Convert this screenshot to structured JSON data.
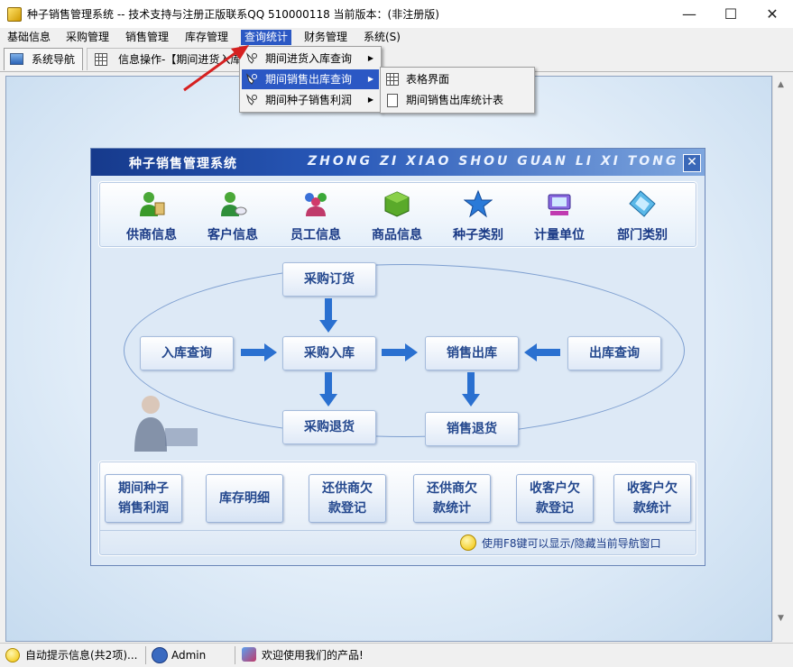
{
  "window": {
    "title": "种子销售管理系统 -- 技术支持与注册正版联系QQ 510000118    当前版本：(非注册版)",
    "controls": {
      "minimize": "—",
      "maximize": "☐",
      "close": "✕"
    }
  },
  "menubar": {
    "items": [
      {
        "label": "基础信息"
      },
      {
        "label": "采购管理"
      },
      {
        "label": "销售管理"
      },
      {
        "label": "库存管理"
      },
      {
        "label": "查询统计",
        "active": true
      },
      {
        "label": "财务管理"
      },
      {
        "label": "系统(S)"
      }
    ]
  },
  "tabs": [
    {
      "label": "系统导航"
    },
    {
      "label": "信息操作-【期间进货入库"
    }
  ],
  "dropdown": {
    "items": [
      {
        "label": "期间进货入库查询"
      },
      {
        "label": "期间销售出库查询",
        "highlighted": true
      },
      {
        "label": "期间种子销售利润"
      }
    ],
    "submenu": [
      {
        "label": "表格界面"
      },
      {
        "label": "期间销售出库统计表"
      }
    ]
  },
  "nav_window": {
    "title": "种子销售管理系统",
    "title_en": "ZHONG ZI XIAO SHOU GUAN LI XI TONG",
    "close": "✕",
    "icons": [
      {
        "label": "供商信息",
        "icon": "supplier-icon",
        "color": "#3a9a2a"
      },
      {
        "label": "客户信息",
        "icon": "customer-icon",
        "color": "#2f8f3a"
      },
      {
        "label": "员工信息",
        "icon": "staff-icon",
        "color": "#c03a6a"
      },
      {
        "label": "商品信息",
        "icon": "product-icon",
        "color": "#4a9a2a"
      },
      {
        "label": "种子类别",
        "icon": "star-icon",
        "color": "#2a7ad8"
      },
      {
        "label": "计量单位",
        "icon": "unit-icon",
        "color": "#6a4ad0"
      },
      {
        "label": "部门类别",
        "icon": "department-icon",
        "color": "#4aa8d8"
      }
    ],
    "flow": {
      "purchase_order": "采购订货",
      "inbound_query": "入库查询",
      "purchase_inbound": "采购入库",
      "sales_outbound": "销售出库",
      "outbound_query": "出库查询",
      "purchase_return": "采购退货",
      "sales_return": "销售退货"
    },
    "bottom_buttons": [
      {
        "line1": "期间种子",
        "line2": "销售利润"
      },
      {
        "line1": "库存明细",
        "line2": ""
      },
      {
        "line1": "还供商欠",
        "line2": "款登记"
      },
      {
        "line1": "还供商欠",
        "line2": "款统计"
      },
      {
        "line1": "收客户欠",
        "line2": "款登记"
      },
      {
        "line1": "收客户欠",
        "line2": "款统计"
      }
    ],
    "tip": "使用F8键可以显示/隐藏当前导航窗口"
  },
  "statusbar": {
    "hint": "自动提示信息(共2项)...",
    "user": "Admin",
    "welcome": "欢迎使用我们的产品!"
  },
  "colors": {
    "accent": "#2b58c4",
    "nav_title_bg": "#1f4aa8",
    "button_text": "#24488e",
    "annotation_arrow": "#d62020"
  }
}
